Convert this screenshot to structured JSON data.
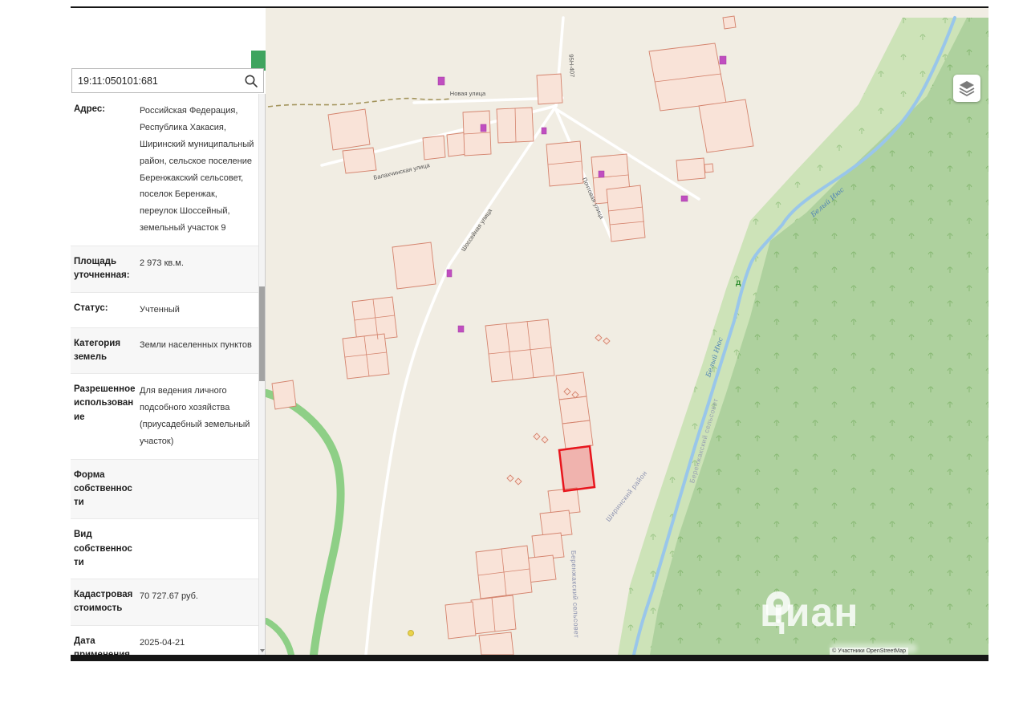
{
  "search": {
    "value": "19:11:050101:681"
  },
  "sidebar": {
    "rows": [
      {
        "label": "Адрес:",
        "value": "Российская Федерация, Республика Хакасия, Ширинский муниципальный район, сельское поселение Беренжакский сельсовет, поселок Беренжак, переулок Шоссейный, земельный участок 9"
      },
      {
        "label": "Площадь уточненная:",
        "value": "2 973 кв.м."
      },
      {
        "label": "Статус:",
        "value": "Учтенный"
      },
      {
        "label": "Категория земель",
        "value": "Земли населенных пунктов"
      },
      {
        "label": "Разрешенное использование",
        "value": "Для ведения личного подсобного хозяйства (приусадебный земельный участок)"
      },
      {
        "label": "Форма собственности",
        "value": ""
      },
      {
        "label": "Вид собственности",
        "value": ""
      },
      {
        "label": "Кадастровая стоимость",
        "value": "70 727.67 руб."
      },
      {
        "label": "Дата применения кадастровой",
        "value": "2025-04-21"
      }
    ]
  },
  "map": {
    "street_novaya": "Новая улица",
    "street_balakhchinskaya": "Балахчинская улица",
    "street_shosseynaya": "Шоссейная улица",
    "street_pochtovaya": "Почтовая улица",
    "road_ref": "95Н-407",
    "river_label_1": "Белый Июс",
    "river_label_2": "Белый Июс",
    "district_label": "Ширинский район",
    "selsovet_label": "Беренжакский сельсовет",
    "selsovet_label_2": "Беренжакский сельсовет",
    "tree_mark": "д",
    "attribution": "© Участники OpenStreetMap"
  },
  "watermark": {
    "brand": "циан"
  },
  "colors": {
    "selected_parcel": "#e8151d",
    "parcel_fill": "#f9e3d8",
    "parcel_stroke": "#d4836d",
    "forest_dark": "#aed19e",
    "forest_light": "#cde3b8",
    "water": "#99c6ea",
    "building": "#c04ec0",
    "map_bg": "#f1ede3",
    "marker_green": "#3fa45f"
  }
}
